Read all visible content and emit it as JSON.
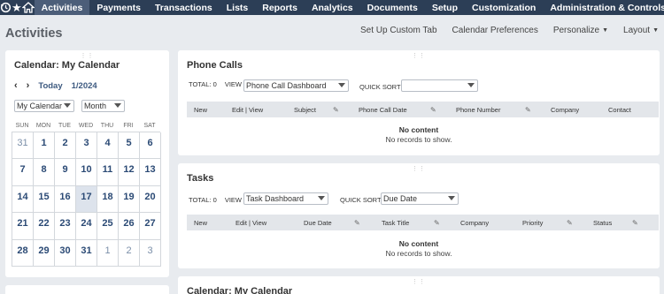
{
  "nav": {
    "items": [
      "Activities",
      "Payments",
      "Transactions",
      "Lists",
      "Reports",
      "Analytics",
      "Documents",
      "Setup",
      "Customization",
      "Administration & Controls"
    ],
    "active": "Activities",
    "more": "•••"
  },
  "page": {
    "title": "Activities",
    "actions": {
      "setup_custom_tab": "Set Up Custom Tab",
      "calendar_preferences": "Calendar Preferences",
      "personalize": "Personalize",
      "layout": "Layout"
    }
  },
  "calendar": {
    "title": "Calendar: My Calendar",
    "today_label": "Today",
    "month_label": "1/2024",
    "calendar_select": "My Calendar",
    "view_select": "Month",
    "weekdays": [
      "SUN",
      "MON",
      "TUE",
      "WED",
      "THU",
      "FRI",
      "SAT"
    ],
    "days": [
      {
        "d": "31",
        "other": true
      },
      {
        "d": "1"
      },
      {
        "d": "2"
      },
      {
        "d": "3"
      },
      {
        "d": "4"
      },
      {
        "d": "5"
      },
      {
        "d": "6"
      },
      {
        "d": "7"
      },
      {
        "d": "8"
      },
      {
        "d": "9"
      },
      {
        "d": "10"
      },
      {
        "d": "11"
      },
      {
        "d": "12"
      },
      {
        "d": "13"
      },
      {
        "d": "14"
      },
      {
        "d": "15"
      },
      {
        "d": "16"
      },
      {
        "d": "17",
        "today": true
      },
      {
        "d": "18"
      },
      {
        "d": "19"
      },
      {
        "d": "20"
      },
      {
        "d": "21"
      },
      {
        "d": "22"
      },
      {
        "d": "23"
      },
      {
        "d": "24"
      },
      {
        "d": "25"
      },
      {
        "d": "26"
      },
      {
        "d": "27"
      },
      {
        "d": "28"
      },
      {
        "d": "29"
      },
      {
        "d": "30"
      },
      {
        "d": "31"
      },
      {
        "d": "1",
        "other": true
      },
      {
        "d": "2",
        "other": true
      },
      {
        "d": "3",
        "other": true
      }
    ]
  },
  "phone_calls": {
    "title": "Phone Calls",
    "total": "TOTAL: 0",
    "view_label": "VIEW",
    "view_value": "Phone Call Dashboard",
    "quick_sort_label": "QUICK SORT",
    "quick_sort_value": "",
    "columns": [
      "New",
      "Edit | View",
      "Subject",
      "Phone Call Date",
      "Phone Number",
      "Company",
      "Contact"
    ],
    "empty_title": "No content",
    "empty_text": "No records to show."
  },
  "tasks": {
    "title": "Tasks",
    "total": "TOTAL: 0",
    "view_label": "VIEW",
    "view_value": "Task Dashboard",
    "quick_sort_label": "QUICK SORT",
    "quick_sort_value": "Due Date",
    "columns": [
      "New",
      "Edit | View",
      "Due Date",
      "Task Title",
      "Company",
      "Priority",
      "Status"
    ],
    "empty_title": "No content",
    "empty_text": "No records to show."
  },
  "calendar2": {
    "title": "Calendar: My Calendar"
  },
  "colors": {
    "nav_bg": "#2c3e56",
    "nav_active": "#4c5e79",
    "page_bg": "#e8ebef",
    "link": "#2b4a75"
  }
}
